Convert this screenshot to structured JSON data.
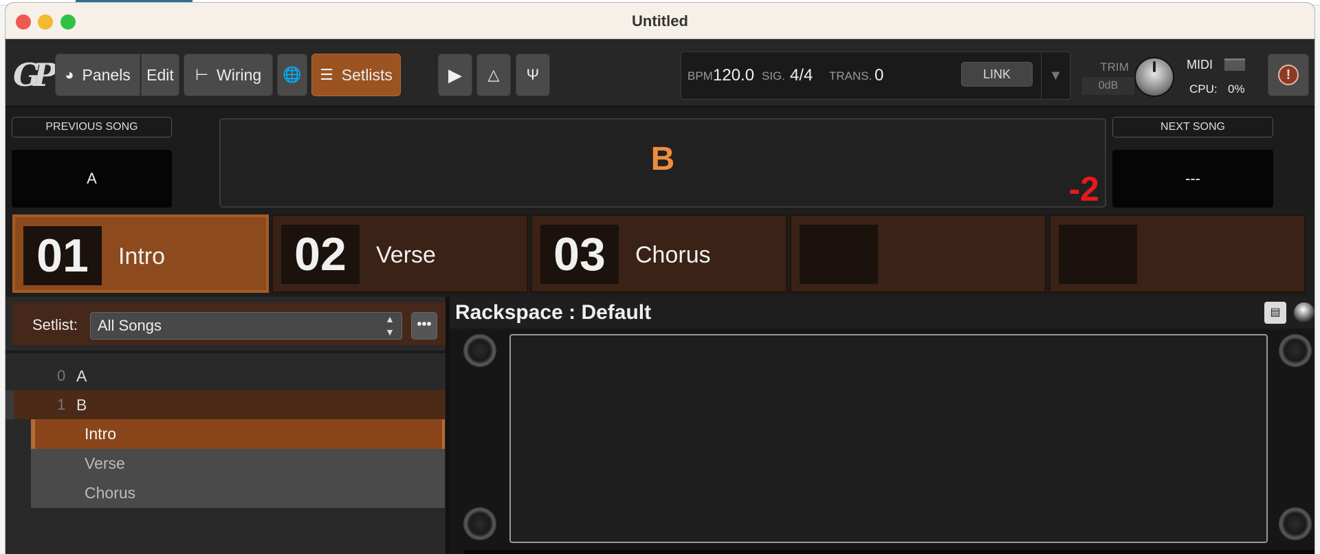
{
  "window": {
    "title": "Untitled"
  },
  "toolbar": {
    "logo": "GP",
    "panels_label": "Panels",
    "edit_label": "Edit",
    "wiring_label": "Wiring",
    "setlists_label": "Setlists",
    "transport": {
      "bpm_label": "BPM",
      "bpm_value": "120.0",
      "sig_label": "SIG.",
      "sig_value": "4/4",
      "trans_label": "TRANS.",
      "trans_value": "0",
      "link_label": "LINK"
    },
    "trim_label": "TRIM",
    "trim_value": "0dB",
    "midi_label": "MIDI",
    "cpu_label": "CPU:",
    "cpu_value": "0%"
  },
  "songs": {
    "previous_label": "PREVIOUS SONG",
    "previous_value": "A",
    "current_value": "B",
    "transpose": "-2",
    "next_label": "NEXT SONG",
    "next_value": "---"
  },
  "parts": [
    {
      "num": "01",
      "label": "Intro",
      "selected": true
    },
    {
      "num": "02",
      "label": "Verse",
      "selected": false
    },
    {
      "num": "03",
      "label": "Chorus",
      "selected": false
    },
    {
      "num": "",
      "label": "",
      "selected": false
    },
    {
      "num": "",
      "label": "",
      "selected": false
    }
  ],
  "setlist": {
    "label": "Setlist:",
    "selected": "All Songs",
    "more_label": "•••",
    "songs": [
      {
        "idx": "0",
        "name": "A"
      },
      {
        "idx": "1",
        "name": "B"
      }
    ],
    "song_parts": [
      "Intro",
      "Verse",
      "Chorus"
    ]
  },
  "rackspace": {
    "title": "Rackspace : Default"
  },
  "colors": {
    "accent": "#9c5322",
    "current_song": "#ef8d3d",
    "transpose": "#e81919"
  }
}
